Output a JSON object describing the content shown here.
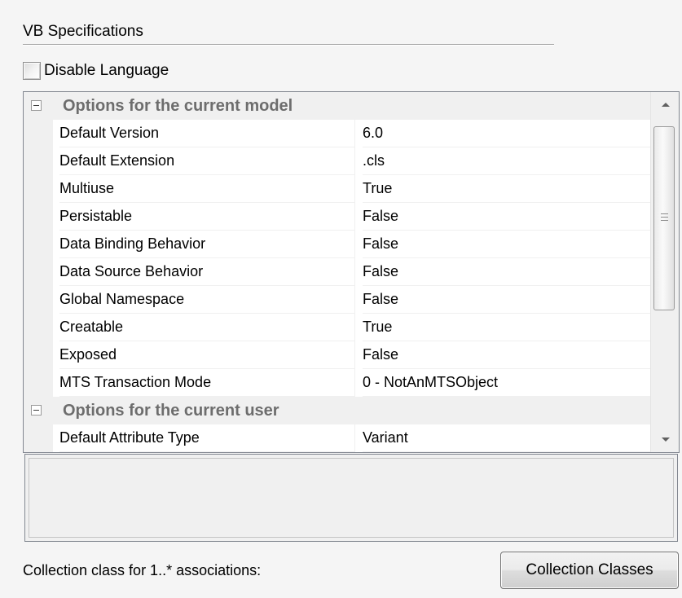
{
  "group": {
    "title": "VB Specifications"
  },
  "disable_language": {
    "label": "Disable Language",
    "checked": false
  },
  "categories": [
    {
      "label": "Options for the current model",
      "expanded": true,
      "properties": [
        {
          "name": "Default Version",
          "value": "6.0"
        },
        {
          "name": "Default Extension",
          "value": ".cls"
        },
        {
          "name": "Multiuse",
          "value": "True"
        },
        {
          "name": "Persistable",
          "value": "False"
        },
        {
          "name": "Data Binding Behavior",
          "value": "False"
        },
        {
          "name": "Data Source Behavior",
          "value": "False"
        },
        {
          "name": "Global Namespace",
          "value": "False"
        },
        {
          "name": "Creatable",
          "value": "True"
        },
        {
          "name": "Exposed",
          "value": "False"
        },
        {
          "name": "MTS Transaction Mode",
          "value": "0 - NotAnMTSObject"
        }
      ]
    },
    {
      "label": "Options for the current user",
      "expanded": true,
      "properties": [
        {
          "name": "Default Attribute Type",
          "value": "Variant"
        }
      ]
    }
  ],
  "footer": {
    "label": "Collection class for 1..* associations:",
    "button_label": "Collection Classes"
  },
  "icons": {
    "expander": "minus-box-icon",
    "scroll_up": "triangle-up-icon",
    "scroll_down": "triangle-down-icon"
  },
  "colors": {
    "background": "#f5f5f5",
    "category_text": "#6d6d6d",
    "grid_border": "#828790",
    "gutter": "#f0f0f0"
  }
}
